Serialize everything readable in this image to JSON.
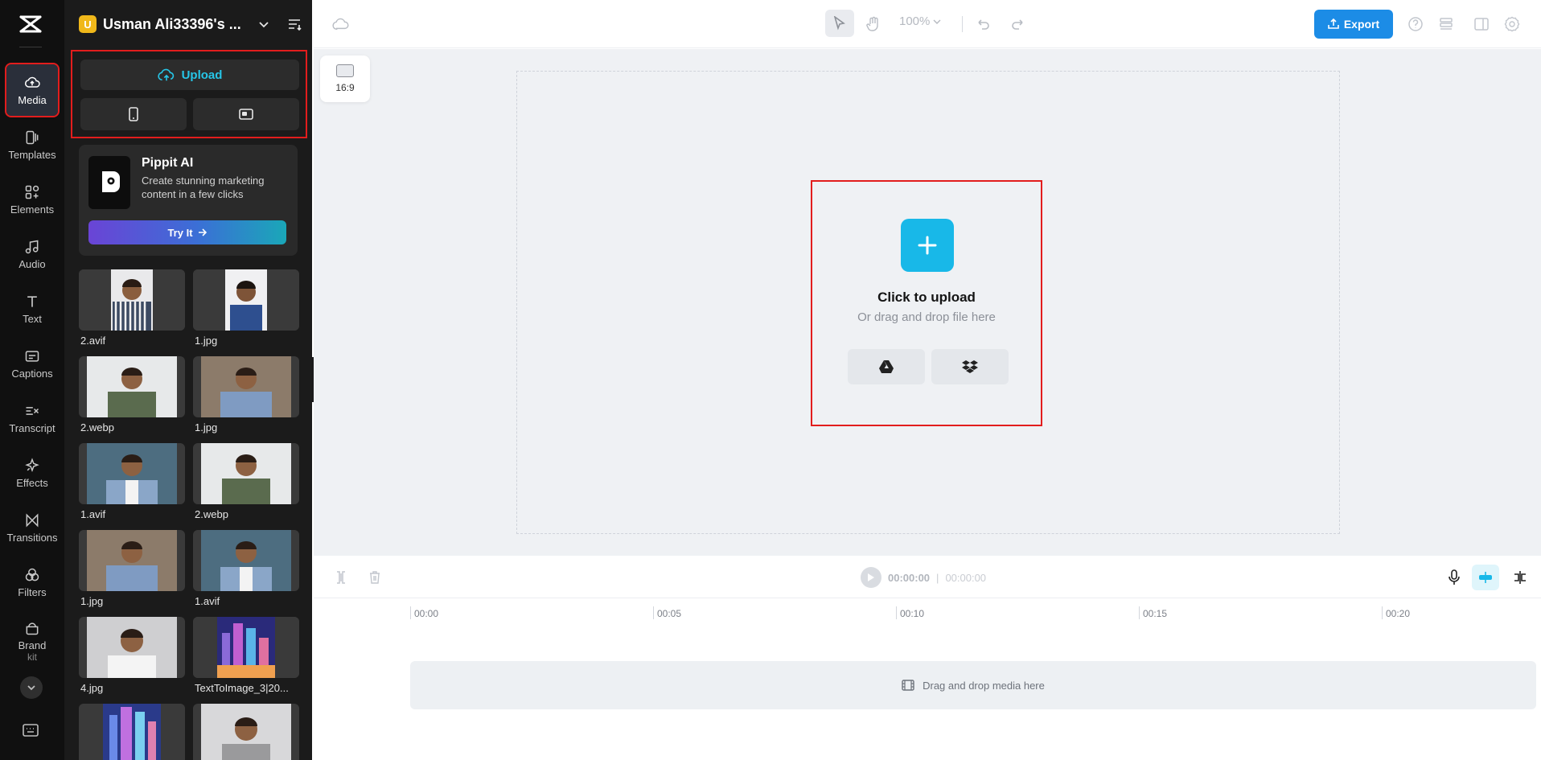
{
  "rail": {
    "items": [
      {
        "label": "Media",
        "icon": "cloud-upload-icon"
      },
      {
        "label": "Templates",
        "icon": "templates-icon"
      },
      {
        "label": "Elements",
        "icon": "elements-icon"
      },
      {
        "label": "Audio",
        "icon": "music-note-icon"
      },
      {
        "label": "Text",
        "icon": "text-icon"
      },
      {
        "label": "Captions",
        "icon": "captions-icon"
      },
      {
        "label": "Transcript",
        "icon": "transcript-icon"
      },
      {
        "label": "Effects",
        "icon": "sparkle-icon"
      },
      {
        "label": "Transitions",
        "icon": "transitions-icon"
      },
      {
        "label": "Filters",
        "icon": "filters-icon"
      },
      {
        "label": "Brand",
        "sub": "kit",
        "icon": "brand-kit-icon"
      }
    ]
  },
  "workspace": {
    "avatar_letter": "U",
    "name": "Usman Ali33396's ..."
  },
  "upload": {
    "label": "Upload"
  },
  "pippit": {
    "title": "Pippit AI",
    "description": "Create stunning marketing content in a few clicks",
    "button": "Try It"
  },
  "media_items": [
    {
      "name": "2.avif"
    },
    {
      "name": "1.jpg"
    },
    {
      "name": "2.webp"
    },
    {
      "name": "1.jpg"
    },
    {
      "name": "1.avif"
    },
    {
      "name": "2.webp"
    },
    {
      "name": "1.jpg"
    },
    {
      "name": "1.avif"
    },
    {
      "name": "4.jpg"
    },
    {
      "name": "TextToImage_3|20..."
    },
    {
      "name": ""
    },
    {
      "name": ""
    }
  ],
  "toolbar": {
    "zoom": "100%",
    "export": "Export"
  },
  "canvas": {
    "ratio": "16:9",
    "click_to_upload": "Click to upload",
    "drag_hint": "Or drag and drop file here"
  },
  "timeline": {
    "current": "00:00:00",
    "separator": "|",
    "total": "00:00:00",
    "ticks": [
      "00:00",
      "00:05",
      "00:10",
      "00:15",
      "00:20"
    ],
    "drop_hint": "Drag and drop media here"
  },
  "colors": {
    "accent": "#18b8e8",
    "export": "#1c8ce6",
    "highlight": "#e21d1d"
  }
}
